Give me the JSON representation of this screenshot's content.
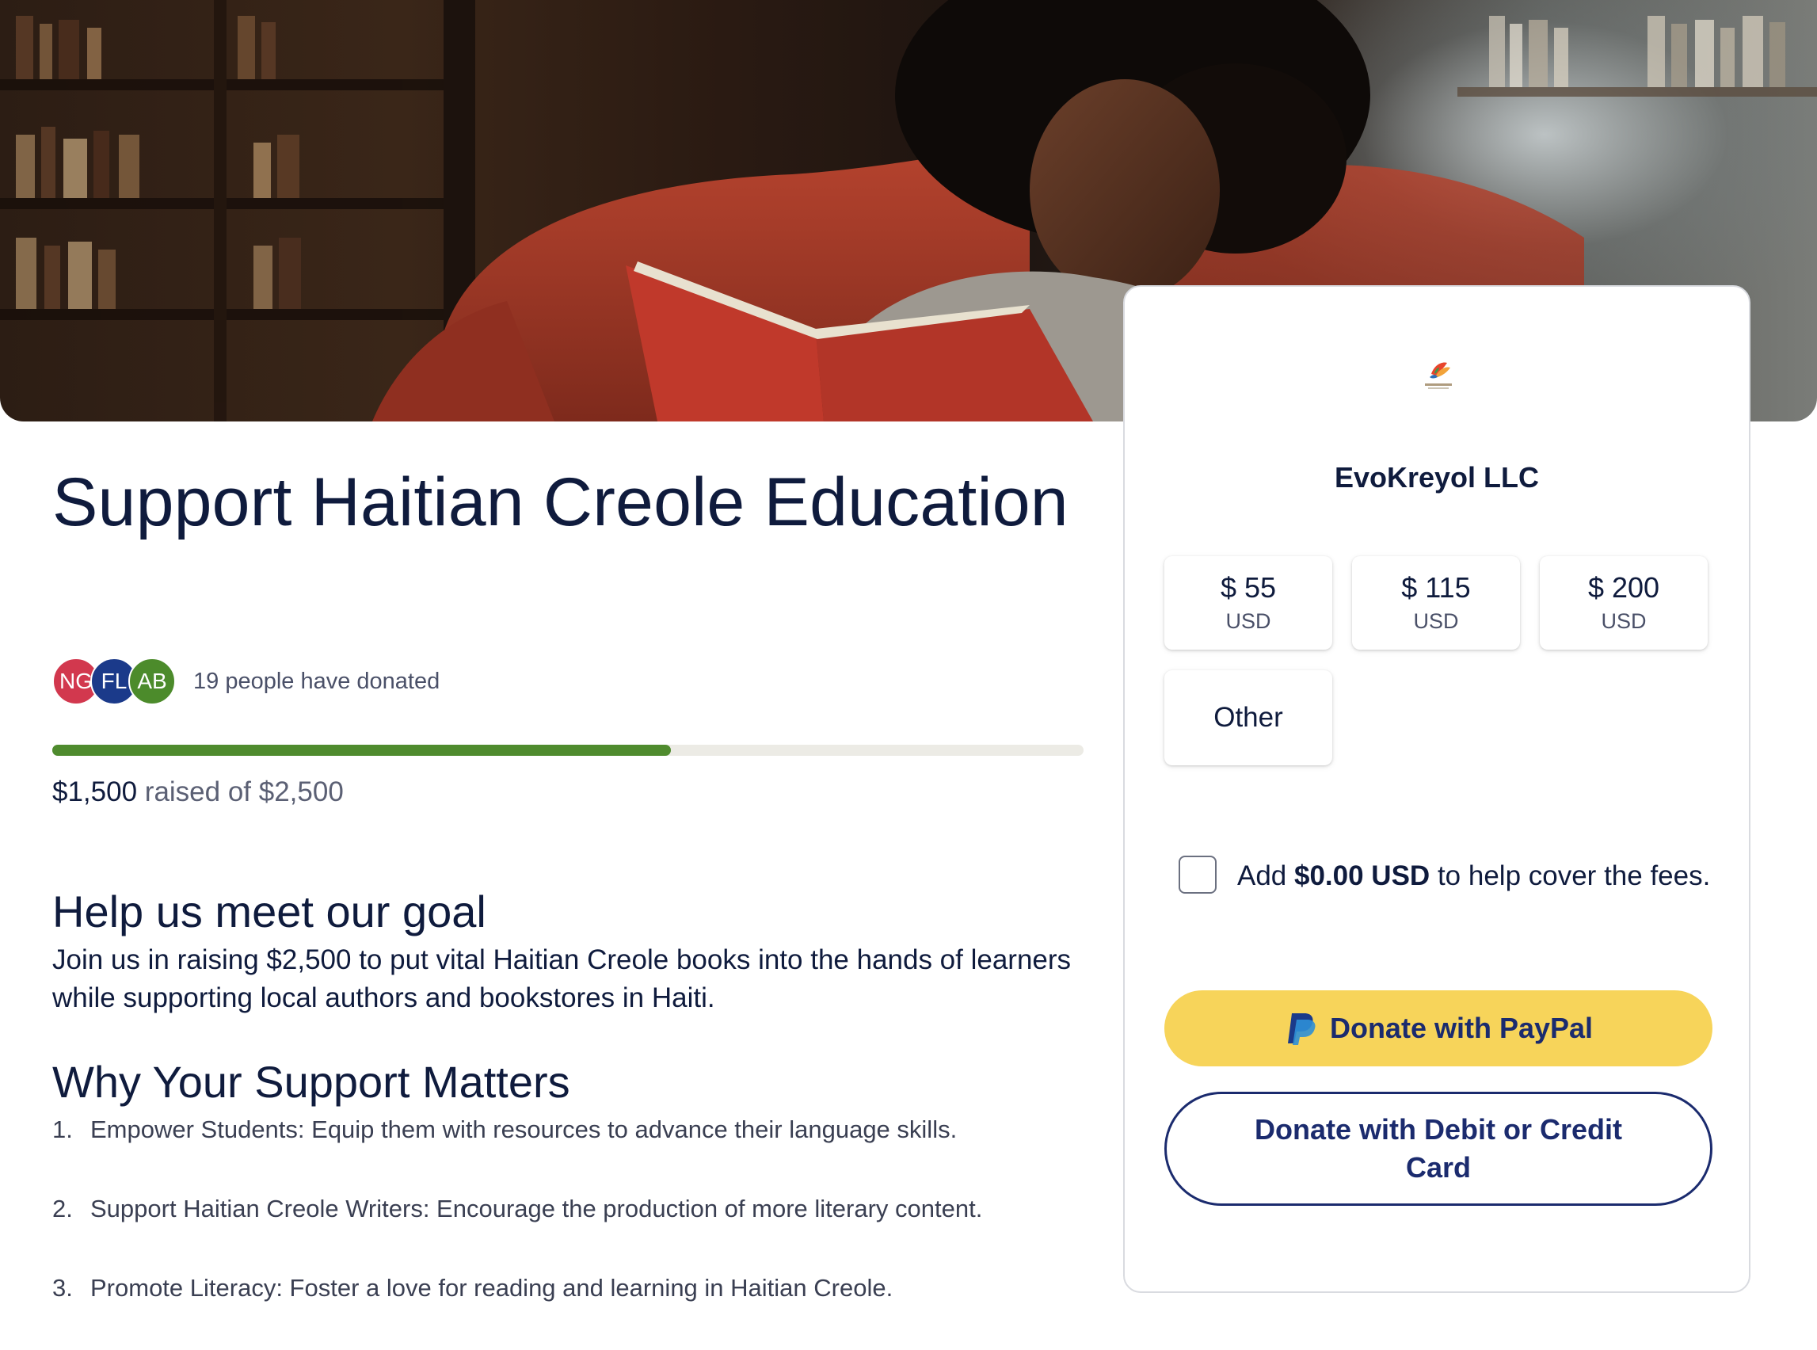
{
  "hero": {
    "image_description": "hero-photo-woman-reading"
  },
  "campaign": {
    "title": "Support Haitian Creole Education",
    "donors": {
      "avatars": [
        "NG",
        "FL",
        "AB"
      ],
      "avatar_colors": [
        "#d2384e",
        "#1b3a8a",
        "#4c8b2b"
      ],
      "text": "19 people have donated"
    },
    "progress": {
      "raised": 1500,
      "goal": 2500,
      "fill_color": "#4f8b2e"
    },
    "raised_amount_text": "$1,500",
    "raised_suffix_text": " raised of $2,500",
    "goal_heading": "Help us meet our goal",
    "goal_paragraph": "Join us in raising $2,500 to put vital Haitian Creole books into the hands of learners while supporting local authors and bookstores in Haiti.",
    "why_heading": "Why Your Support Matters",
    "reasons": [
      {
        "num": "1.",
        "text": "Empower Students: Equip them with resources to advance their language skills."
      },
      {
        "num": "2.",
        "text": "Support Haitian Creole Writers: Encourage the production of more literary content."
      },
      {
        "num": "3.",
        "text": "Promote Literacy: Foster a love for reading and learning in Haitian Creole."
      }
    ]
  },
  "donation_card": {
    "logo_text": "EvoKreyol",
    "org_name": "EvoKreyol LLC",
    "amounts": [
      {
        "value": "$ 55",
        "currency": "USD"
      },
      {
        "value": "$ 115",
        "currency": "USD"
      },
      {
        "value": "$ 200",
        "currency": "USD"
      }
    ],
    "other_label": "Other",
    "fee": {
      "prefix": "Add ",
      "amount": "$0.00 USD",
      "suffix": " to help cover the fees.",
      "checked": false
    },
    "paypal_label": "Donate with PayPal",
    "card_label": "Donate with Debit or Credit Card",
    "colors": {
      "paypal_bg": "#f7d45a",
      "primary_navy": "#1b2b6e"
    }
  }
}
